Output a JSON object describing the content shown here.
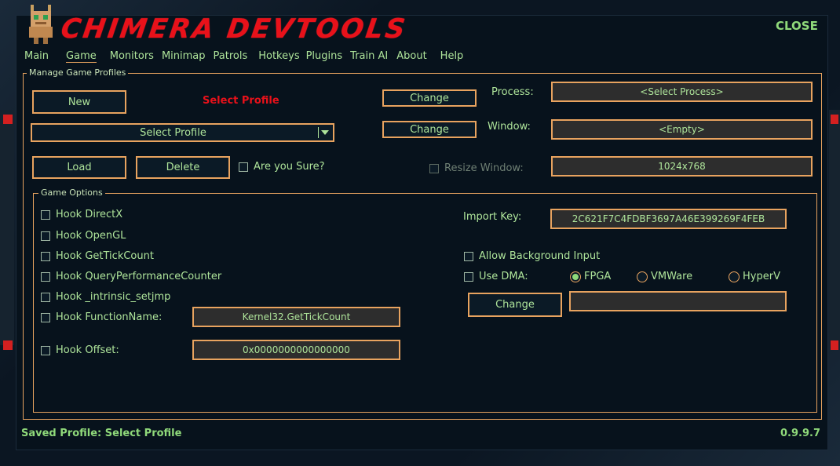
{
  "app": {
    "title": "CHIMERA DEVTOOLS",
    "close_label": "CLOSE"
  },
  "menu": {
    "items": [
      {
        "label": "Main"
      },
      {
        "label": "Game"
      },
      {
        "label": "Monitors"
      },
      {
        "label": "Minimap"
      },
      {
        "label": "Patrols"
      },
      {
        "label": "Hotkeys"
      },
      {
        "label": "Plugins"
      },
      {
        "label": "Train AI"
      },
      {
        "label": "About"
      },
      {
        "label": "Help"
      }
    ],
    "active": "Game"
  },
  "profiles": {
    "group_label": "Manage Game Profiles",
    "new_label": "New",
    "selected_profile_text": "Select Profile",
    "dropdown_value": "Select Profile",
    "load_label": "Load",
    "delete_label": "Delete",
    "confirm_label": "Are you Sure?",
    "process_change_label": "Change",
    "process_label": "Process:",
    "process_value": "<Select Process>",
    "window_change_label": "Change",
    "window_label": "Window:",
    "window_value": "<Empty>",
    "resize_label": "Resize Window:",
    "resize_value": "1024x768"
  },
  "options": {
    "group_label": "Game Options",
    "hooks": [
      {
        "label": "Hook DirectX"
      },
      {
        "label": "Hook OpenGL"
      },
      {
        "label": "Hook GetTickCount"
      },
      {
        "label": "Hook QueryPerformanceCounter"
      },
      {
        "label": "Hook _intrinsic_setjmp"
      },
      {
        "label": "Hook FunctionName:"
      },
      {
        "label": "Hook Offset:"
      }
    ],
    "function_name_value": "Kernel32.GetTickCount",
    "offset_value": "0x0000000000000000",
    "import_key_label": "Import Key:",
    "import_key_value": "2C621F7C4FDBF3697A46E399269F4FEB",
    "allow_bg_label": "Allow Background Input",
    "use_dma_label": "Use DMA:",
    "dma_options": [
      {
        "label": "FPGA",
        "selected": true
      },
      {
        "label": "VMWare",
        "selected": false
      },
      {
        "label": "HyperV",
        "selected": false
      }
    ],
    "dma_change_label": "Change",
    "dma_value": ""
  },
  "status": {
    "saved_profile": "Saved Profile: Select Profile",
    "version": "0.9.9.7"
  },
  "colors": {
    "accent_orange": "#e8a35f",
    "text_green": "#aee49a",
    "title_red": "#e8111a",
    "background": "#07121c"
  }
}
